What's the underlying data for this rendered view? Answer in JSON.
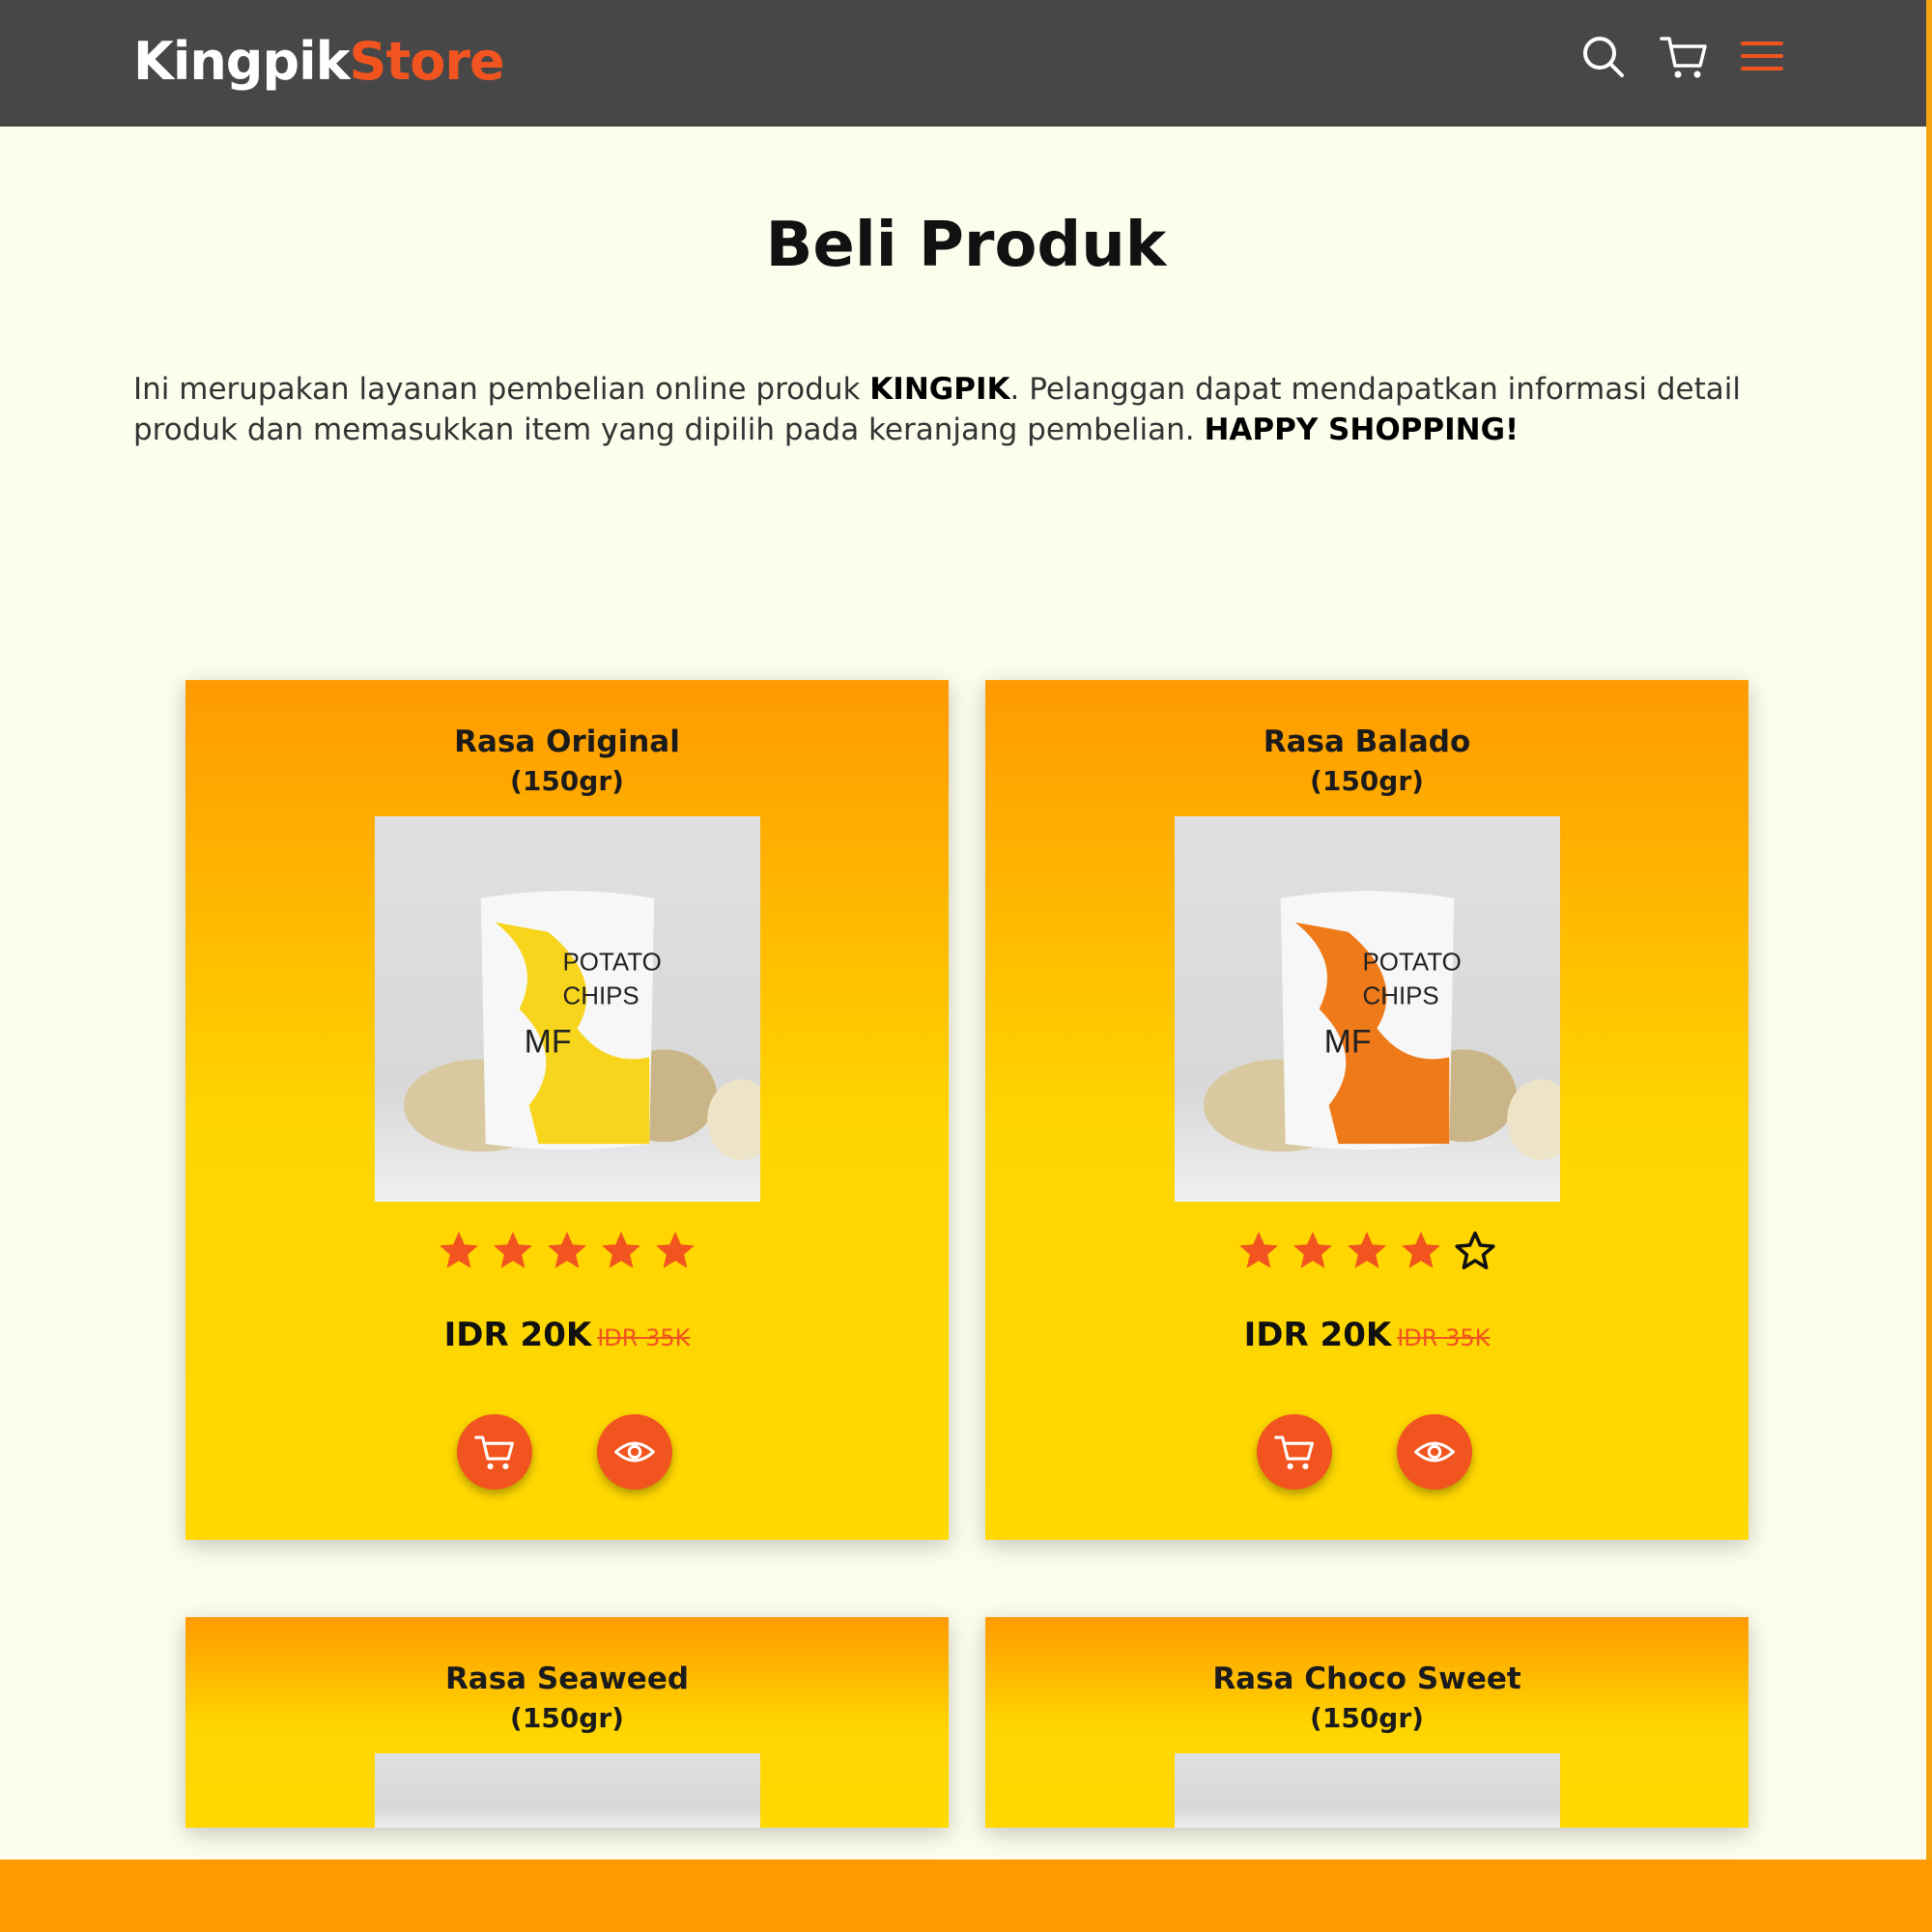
{
  "header": {
    "logo_part1": "Kingpik",
    "logo_part2": "Store",
    "icons": [
      "search-icon",
      "cart-icon",
      "menu-icon"
    ]
  },
  "page": {
    "title": "Beli Produk",
    "intro_text_1": "Ini merupakan layanan pembelian online produk ",
    "intro_brand": "KINGPIK",
    "intro_text_2": ". Pelanggan dapat mendapatkan informasi detail produk dan memasukkan item yang dipilih pada keranjang pembelian. ",
    "intro_closing": "HAPPY SHOPPING!"
  },
  "products": [
    {
      "name": "Rasa Original",
      "weight": "(150gr)",
      "rating": 5,
      "price": "IDR 20K",
      "old_price": "IDR 35K",
      "chip_color": "#f7d51d"
    },
    {
      "name": "Rasa Balado",
      "weight": "(150gr)",
      "rating": 4,
      "price": "IDR 20K",
      "old_price": "IDR 35K",
      "chip_color": "#ef7a1a"
    },
    {
      "name": "Rasa Seaweed",
      "weight": "(150gr)"
    },
    {
      "name": "Rasa Choco Sweet",
      "weight": "(150gr)"
    }
  ],
  "colors": {
    "navbar": "#474747",
    "accent": "#f2541f",
    "card_top": "#ff9a00",
    "card_bottom": "#ffd900",
    "background": "#fdfdee"
  }
}
